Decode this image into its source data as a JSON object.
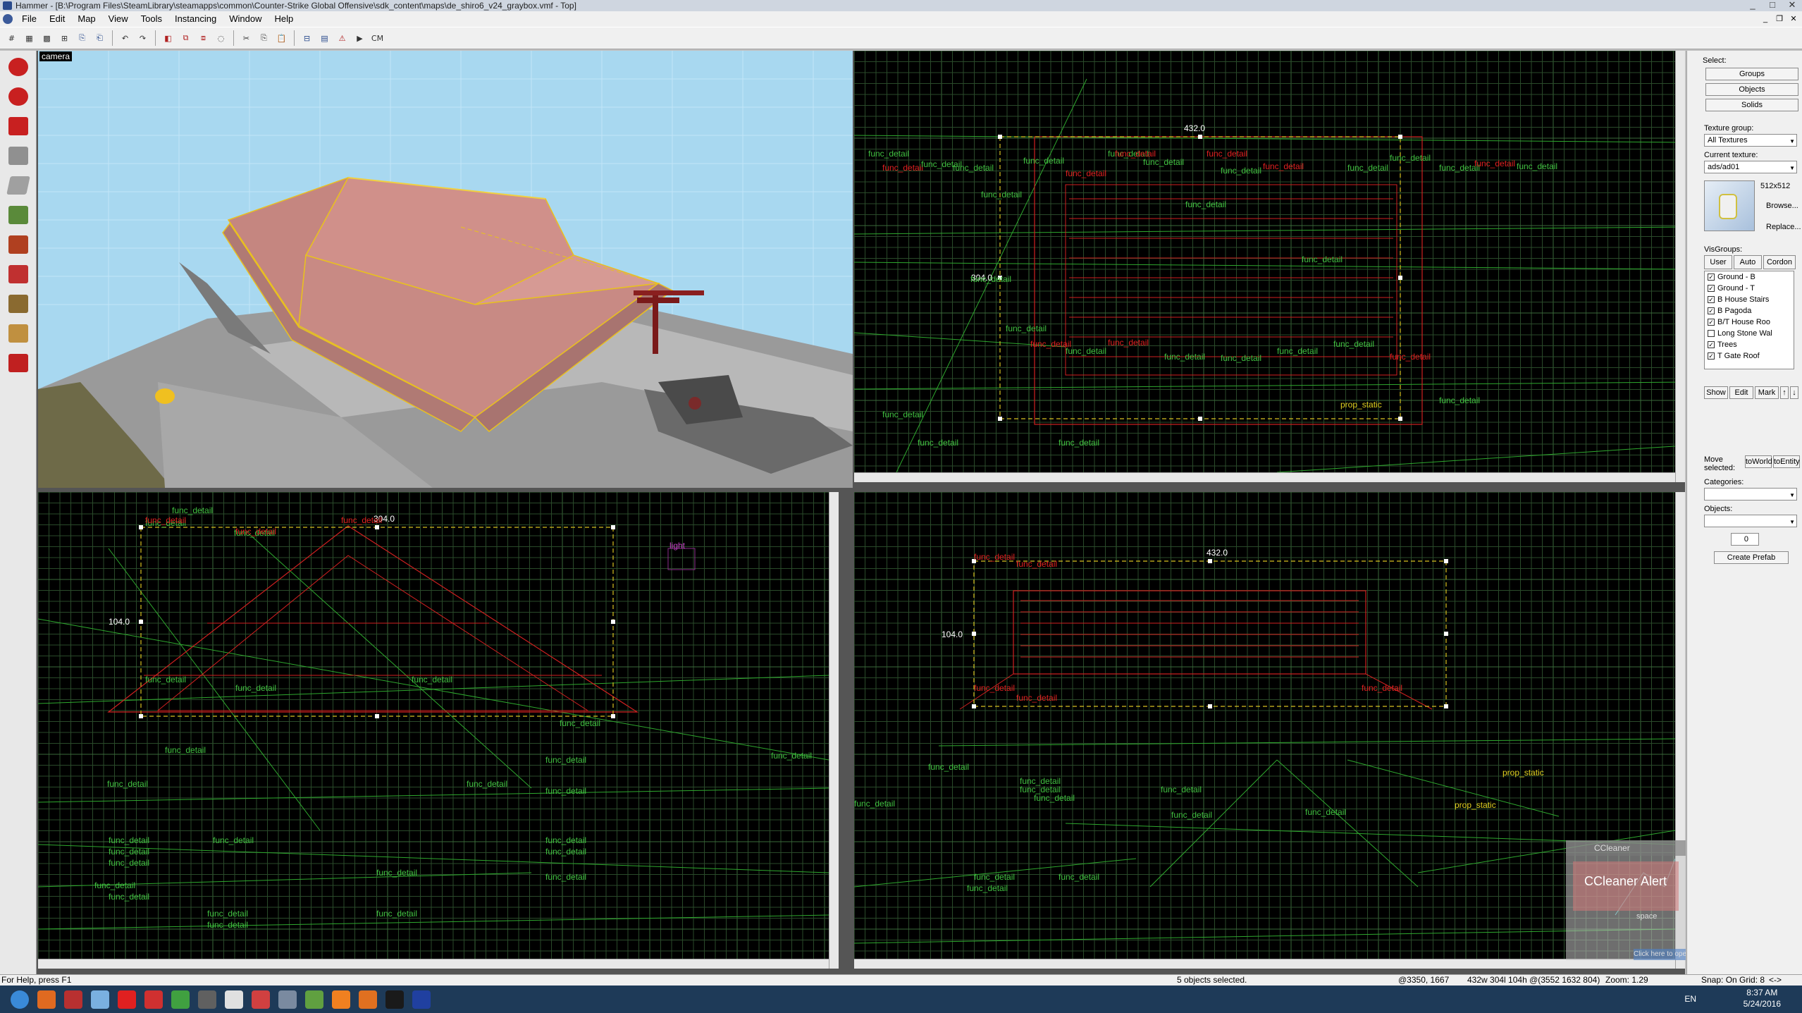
{
  "window": {
    "title": "Hammer - [B:\\Program Files\\SteamLibrary\\steamapps\\common\\Counter-Strike Global Offensive\\sdk_content\\maps\\de_shiro6_v24_graybox.vmf - Top]",
    "controls": [
      "_",
      "□",
      "✕"
    ]
  },
  "menu": [
    "File",
    "Edit",
    "Map",
    "View",
    "Tools",
    "Instancing",
    "Window",
    "Help"
  ],
  "mdi_controls": [
    "_",
    "❐",
    "✕"
  ],
  "toolbar_icons": [
    "grid-icon",
    "grid-smaller-icon",
    "grid-larger-icon",
    "grid-toggle-icon",
    "load-window-state-icon",
    "save-window-state-icon",
    "undo-icon",
    "redo-icon",
    "carve-icon",
    "group-icon",
    "ungroup-icon",
    "hide-icon",
    "cut-icon",
    "copy-icon",
    "paste-icon",
    "texture-lock-icon",
    "entity-report-icon",
    "check-problems-icon",
    "run-map-icon"
  ],
  "toolbar_right_label": "CM",
  "left_tools": [
    {
      "name": "selection-tool",
      "color": "#c82020"
    },
    {
      "name": "magnify-tool",
      "color": "#c82020"
    },
    {
      "name": "camera-tool",
      "color": "#c82020"
    },
    {
      "name": "entity-tool",
      "color": "#909090"
    },
    {
      "name": "block-tool",
      "color": "#a0a0a0"
    },
    {
      "name": "texture-application-tool",
      "color": "#5a8a3a"
    },
    {
      "name": "apply-current-texture-tool",
      "color": "#b04020"
    },
    {
      "name": "decal-tool",
      "color": "#c03030"
    },
    {
      "name": "overlay-tool",
      "color": "#8a6a30"
    },
    {
      "name": "clipping-tool",
      "color": "#c09040"
    },
    {
      "name": "vertex-tool",
      "color": "#c02020"
    }
  ],
  "viewports": {
    "camera": {
      "label": "camera"
    },
    "top": {
      "dim_width": "432.0",
      "dim_height": "304.0",
      "entity_label": "func_detail",
      "prop_label": "prop_static"
    },
    "front": {
      "dim_width": "304.0",
      "dim_height": "104.0",
      "entity_label": "func_detail",
      "light_label": "light"
    },
    "side": {
      "dim_width": "432.0",
      "dim_height": "104.0",
      "entity_label": "func_detail",
      "prop_label": "prop_static"
    }
  },
  "right_panel": {
    "select_label": "Select:",
    "select_buttons": [
      "Groups",
      "Objects",
      "Solids"
    ],
    "texture_group_label": "Texture group:",
    "texture_group_value": "All Textures",
    "current_texture_label": "Current texture:",
    "current_texture_value": "ads/ad01",
    "texture_size": "512x512",
    "browse_label": "Browse...",
    "replace_label": "Replace...",
    "visgroups_label": "VisGroups:",
    "visgroup_tabs": [
      "User",
      "Auto",
      "Cordon"
    ],
    "visgroups": [
      {
        "name": "Ground - B",
        "checked": "✓"
      },
      {
        "name": "Ground - T",
        "checked": "✓"
      },
      {
        "name": "B House Stairs",
        "checked": "✓"
      },
      {
        "name": "B Pagoda",
        "checked": "✓"
      },
      {
        "name": "B/T House Roo",
        "checked": "✓"
      },
      {
        "name": "Long Stone Wal",
        "checked": ""
      },
      {
        "name": "Trees",
        "checked": "✓"
      },
      {
        "name": "T Gate Roof",
        "checked": "✓"
      }
    ],
    "visgroup_buttons": [
      "Show",
      "Edit",
      "Mark",
      "↑",
      "↓"
    ],
    "move_selected_label": "Move selected:",
    "to_world_label": "toWorld",
    "to_entity_label": "toEntity",
    "categories_label": "Categories:",
    "objects_label": "Objects:",
    "objects_count": "0",
    "create_prefab_label": "Create Prefab"
  },
  "status": {
    "help": "For Help, press F1",
    "selection": "5 objects selected.",
    "cursor": "@3350, 1667",
    "size": "432w 304l 104h @(3552 1632 804)",
    "zoom": "Zoom: 1.29",
    "snap": "Snap: On Grid: 8",
    "arrow": "<->"
  },
  "taskbar": {
    "apps": [
      {
        "name": "start-button",
        "color": "#3a8ad8"
      },
      {
        "name": "firefox-icon",
        "color": "#e06a20"
      },
      {
        "name": "app-icon-2",
        "color": "#b83030"
      },
      {
        "name": "notepad-icon",
        "color": "#7ab0e0"
      },
      {
        "name": "app-icon-s",
        "color": "#e02020"
      },
      {
        "name": "app-icon-flash",
        "color": "#d03030"
      },
      {
        "name": "app-icon-globe",
        "color": "#40a040"
      },
      {
        "name": "app-icon-steam-gray",
        "color": "#606060"
      },
      {
        "name": "app-icon-doc",
        "color": "#e0e0e0"
      },
      {
        "name": "app-icon-rocket",
        "color": "#d04040"
      },
      {
        "name": "hammer-icon",
        "color": "#7a8aa0"
      },
      {
        "name": "app-icon-green",
        "color": "#60a040"
      },
      {
        "name": "vlc-icon",
        "color": "#f08020"
      },
      {
        "name": "blender-icon",
        "color": "#e07020"
      },
      {
        "name": "steam-icon",
        "color": "#1a1a1a"
      },
      {
        "name": "app-icon-blue-globe",
        "color": "#2040a0"
      }
    ],
    "lang": "EN",
    "time": "8:37 AM",
    "date": "5/24/2016"
  },
  "popup": {
    "title": "CCleaner",
    "line1": "CCleaner Alert",
    "line2": "space",
    "button": "Click here to open CCleaner"
  },
  "colors": {
    "grid": "#2a4a2a",
    "grid_major": "#3a6a3a",
    "detail_green": "#2ea82e",
    "selected_red": "#d02020",
    "bbox_yellow": "#d8c020",
    "label_green": "#40c040",
    "label_yellow": "#e0d020",
    "label_red": "#e02020",
    "sky": "#a8d8f0",
    "roof": "#d0908a"
  }
}
